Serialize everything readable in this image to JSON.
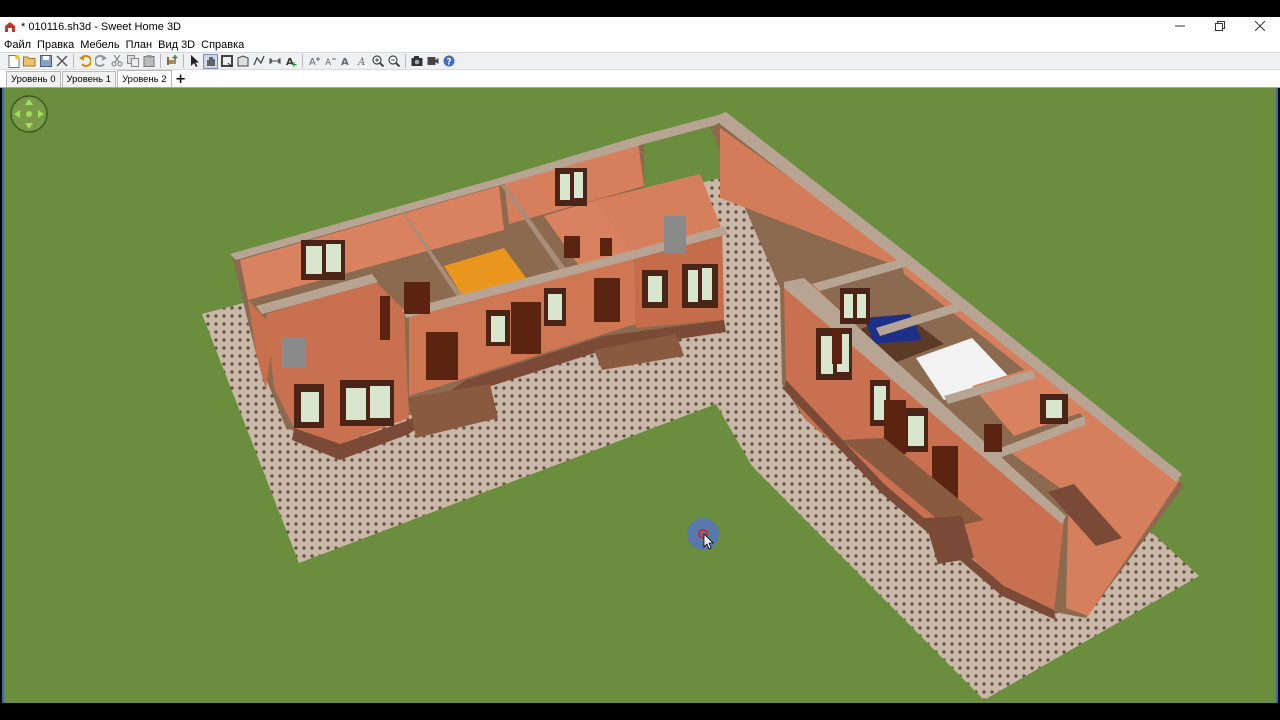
{
  "window": {
    "title": "* 010116.sh3d - Sweet Home 3D",
    "app_icon": "sweet-home-3d-icon",
    "controls": [
      "minimize-icon",
      "restore-icon",
      "close-icon"
    ]
  },
  "menu": {
    "items": [
      "Файл",
      "Правка",
      "Мебель",
      "План",
      "Вид 3D",
      "Справка"
    ]
  },
  "toolbar": {
    "buttons": [
      "new-home-icon",
      "open-icon",
      "save-icon",
      "cut-tool-icon",
      "undo-icon",
      "redo-icon",
      "cut-icon",
      "copy-icon",
      "paste-icon",
      "add-furniture-icon",
      "select-mode-icon",
      "pan-mode-icon",
      "create-walls-icon",
      "create-rooms-icon",
      "create-polylines-icon",
      "create-dimensions-icon",
      "create-labels-icon",
      "increase-text-icon",
      "decrease-text-icon",
      "bold-text-icon",
      "italic-text-icon",
      "zoom-in-icon",
      "zoom-out-icon",
      "create-photo-icon",
      "create-video-icon",
      "help-icon"
    ]
  },
  "levels": {
    "tabs": [
      "Уровень 0",
      "Уровень 1",
      "Уровень 2"
    ],
    "active_index": 2,
    "add_label": "+"
  },
  "view3d": {
    "background_color": "#6b8e3e",
    "widgets": [
      "navigation-arrows-icon",
      "cursor-icon"
    ]
  }
}
